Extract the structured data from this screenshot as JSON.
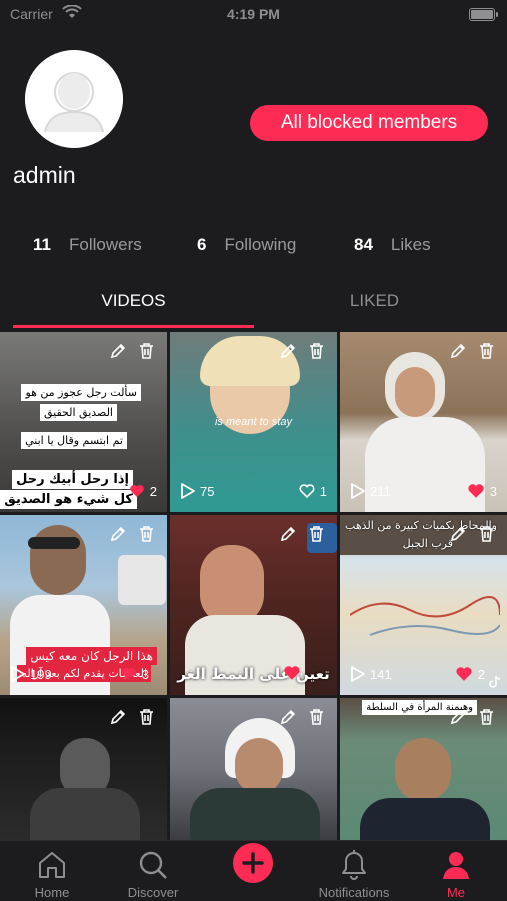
{
  "status_bar": {
    "carrier": "Carrier",
    "time": "4:19 PM"
  },
  "profile": {
    "username": "admin",
    "blocked_button": "All blocked members",
    "stats": [
      {
        "count": "11",
        "label": "Followers"
      },
      {
        "count": "6",
        "label": "Following"
      },
      {
        "count": "84",
        "label": "Likes"
      }
    ]
  },
  "tabs": {
    "videos": "VIDEOS",
    "liked": "LIKED",
    "active": "videos"
  },
  "videos": [
    {
      "views": "",
      "likes": "2",
      "liked": true,
      "captions": [
        "سألت رجل عجوز من هو",
        "الصديق الحقيق",
        "تم ابتسم وقال يا ابني",
        "إذا رحل أبيك رحل",
        "كل شيء هو الصديق"
      ]
    },
    {
      "views": "75",
      "likes": "1",
      "liked": false,
      "captions": [
        "is meant to stay"
      ]
    },
    {
      "views": "211",
      "likes": "3",
      "liked": true,
      "captions": []
    },
    {
      "views": "199",
      "likes": "3",
      "liked": true,
      "captions": [
        "هذا الرجل كان معه كيس",
        "العلاجات يقدم لكم بعد آزاله"
      ]
    },
    {
      "views": "",
      "likes": "",
      "liked": true,
      "captions": [
        "تعين على النمط الغر"
      ]
    },
    {
      "views": "141",
      "likes": "2",
      "liked": true,
      "captions": [
        "والمحاط بكميات كبيرة من الذهب",
        "قرب الجبل"
      ]
    },
    {
      "views": "",
      "likes": "",
      "liked": false,
      "captions": []
    },
    {
      "views": "",
      "likes": "",
      "liked": false,
      "captions": []
    },
    {
      "views": "",
      "likes": "",
      "liked": false,
      "captions": [
        "وهيمنة المرأة في السلطة"
      ]
    }
  ],
  "nav": {
    "home": "Home",
    "discover": "Discover",
    "notifications": "Notifications",
    "me": "Me",
    "active": "me"
  },
  "colors": {
    "accent": "#fe2c55",
    "background": "#1c1c1e",
    "muted": "#8e8e93"
  }
}
